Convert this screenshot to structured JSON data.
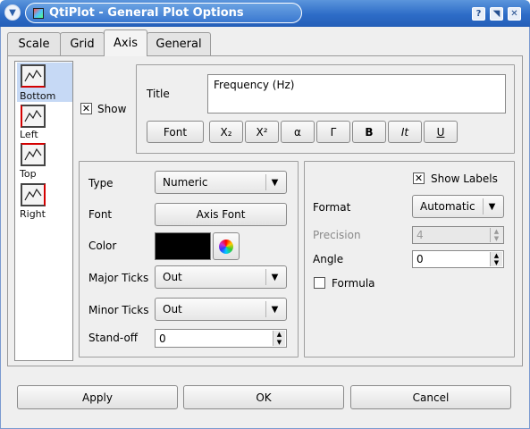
{
  "window": {
    "title": "QtiPlot - General Plot Options",
    "controls": [
      "?",
      "◥",
      "✕"
    ]
  },
  "tabs": [
    {
      "label": "Scale",
      "active": false
    },
    {
      "label": "Grid",
      "active": false
    },
    {
      "label": "Axis",
      "active": true
    },
    {
      "label": "General",
      "active": false
    }
  ],
  "axes": [
    {
      "label": "Bottom",
      "selected": true,
      "accent": "#d40000"
    },
    {
      "label": "Left",
      "selected": false,
      "accent": "#d40000"
    },
    {
      "label": "Top",
      "selected": false,
      "accent": "#d40000"
    },
    {
      "label": "Right",
      "selected": false,
      "accent": "#d40000"
    }
  ],
  "title_group": {
    "show_label": "Show",
    "show_checked": true,
    "title_label": "Title",
    "title_value": "Frequency (Hz)",
    "font_button": "Font",
    "format_buttons": [
      "X₂",
      "X²",
      "α",
      "Γ",
      "B",
      "It",
      "U"
    ]
  },
  "left_group": {
    "type_label": "Type",
    "type_value": "Numeric",
    "font_label": "Font",
    "axis_font_button": "Axis Font",
    "color_label": "Color",
    "color_value": "#000000",
    "major_ticks_label": "Major Ticks",
    "major_ticks_value": "Out",
    "minor_ticks_label": "Minor Ticks",
    "minor_ticks_value": "Out",
    "standoff_label": "Stand-off",
    "standoff_value": "0"
  },
  "right_group": {
    "show_labels_label": "Show Labels",
    "show_labels_checked": true,
    "format_label": "Format",
    "format_value": "Automatic",
    "precision_label": "Precision",
    "precision_value": "4",
    "angle_label": "Angle",
    "angle_value": "0",
    "formula_label": "Formula",
    "formula_checked": false
  },
  "footer": {
    "apply": "Apply",
    "ok": "OK",
    "cancel": "Cancel"
  }
}
